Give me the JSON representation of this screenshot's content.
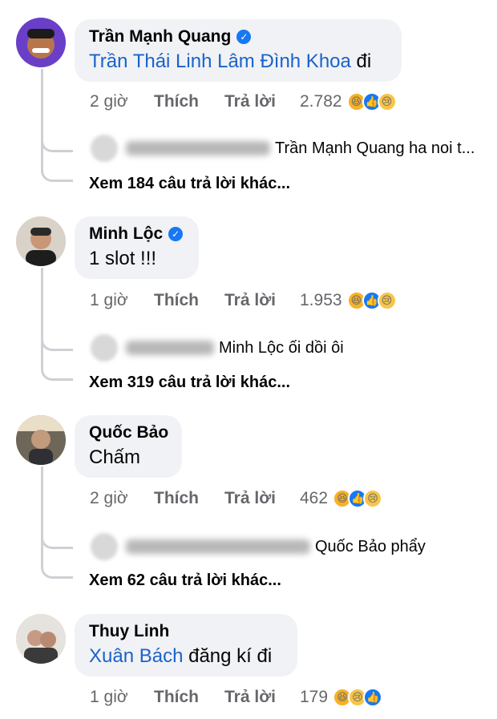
{
  "comments": [
    {
      "author": "Trần Mạnh Quang",
      "verified": true,
      "mention": "Trần Thái Linh Lâm Đình Khoa",
      "text": " đi",
      "time": "2 giờ",
      "like": "Thích",
      "reply": "Trả lời",
      "reactions_count": "2.782",
      "reactions": [
        "haha-icon",
        "like-icon",
        "sad-icon"
      ],
      "reply_preview": "Trần Mạnh Quang  ha noi t...",
      "more_replies": "Xem 184 câu trả lời khác..."
    },
    {
      "author": "Minh Lộc",
      "verified": true,
      "mention": "",
      "text": "1 slot !!!",
      "time": "1 giờ",
      "like": "Thích",
      "reply": "Trả lời",
      "reactions_count": "1.953",
      "reactions": [
        "haha-icon",
        "like-icon",
        "sad-icon"
      ],
      "reply_preview": "Minh Lộc ối dồi ôi",
      "more_replies": "Xem 319 câu trả lời khác..."
    },
    {
      "author": "Quốc Bảo",
      "verified": false,
      "mention": "",
      "text": "Chấm",
      "time": "2 giờ",
      "like": "Thích",
      "reply": "Trả lời",
      "reactions_count": "462",
      "reactions": [
        "haha-icon",
        "like-icon",
        "sad-icon"
      ],
      "reply_preview": "Quốc Bảo phẩy",
      "more_replies": "Xem 62 câu trả lời khác..."
    },
    {
      "author": "Thuy Linh",
      "verified": false,
      "mention": "Xuân Bách",
      "text": " đăng kí đi",
      "time": "1 giờ",
      "like": "Thích",
      "reply": "Trả lời",
      "reactions_count": "179",
      "reactions": [
        "haha-icon",
        "sad-icon",
        "like-icon"
      ]
    }
  ],
  "colors": {
    "mention": "#1b62c9",
    "bubble": "#f0f2f5",
    "meta": "#65676b",
    "verified": "#1877f2"
  }
}
